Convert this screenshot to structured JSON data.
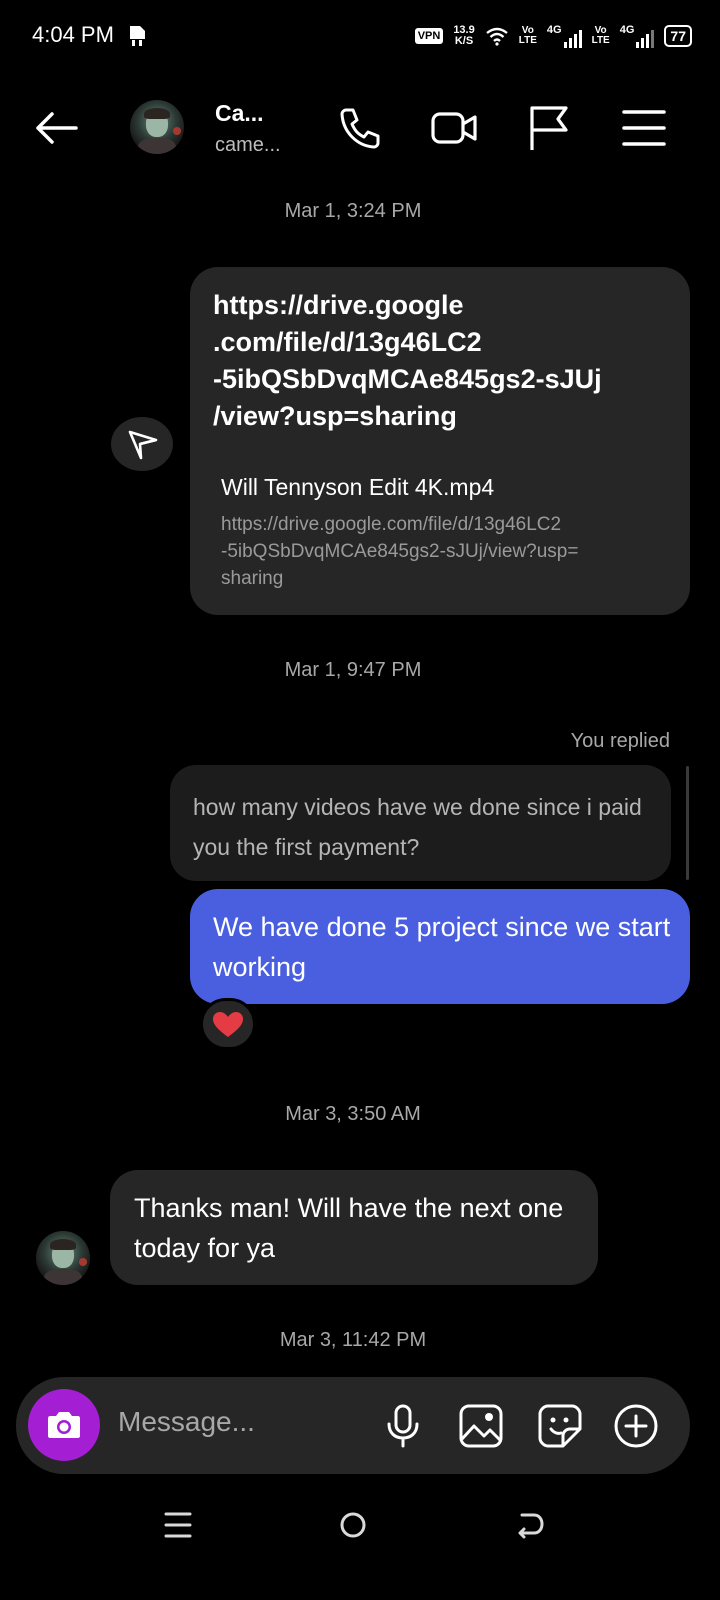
{
  "status_bar": {
    "time": "4:04 PM",
    "vpn": "VPN",
    "net_speed_value": "13.9",
    "net_speed_unit": "K/S",
    "sim1_label": "Vo",
    "sim1_sub": "LTE",
    "sim1_net": "4G",
    "sim2_label": "Vo",
    "sim2_sub": "LTE",
    "sim2_net": "4G",
    "battery": "77"
  },
  "header": {
    "name": "Ca...",
    "username": "came..."
  },
  "messages": {
    "ts1": "Mar 1, 3:24 PM",
    "link_text": "https://drive.google\n.com/file/d/13g46LC2\n-5ibQSbDvqMCAe845gs2-sJUj\n/view?usp=sharing",
    "link_preview_title": "Will Tennyson Edit 4K.mp4",
    "link_preview_url": "https://drive.google.com/file/d/13g46LC2\n-5ibQSbDvqMCAe845gs2-sJUj/view?usp=\nsharing",
    "ts2": "Mar 1, 9:47 PM",
    "you_replied": "You replied",
    "quoted_text": "how many videos have we done since i paid you the first payment?",
    "sent_text": "We have done 5 project since we start working",
    "reaction": "❤️",
    "ts3": "Mar 3, 3:50 AM",
    "received_text": "Thanks man! Will have the next one today for ya",
    "ts4": "Mar 3, 11:42 PM"
  },
  "composer": {
    "placeholder": "Message..."
  },
  "colors": {
    "background": "#000000",
    "bubble_dark": "#262626",
    "bubble_sent": "#4a5fe0",
    "camera_button": "#a41ed4",
    "secondary_text": "#a8a8a8"
  }
}
